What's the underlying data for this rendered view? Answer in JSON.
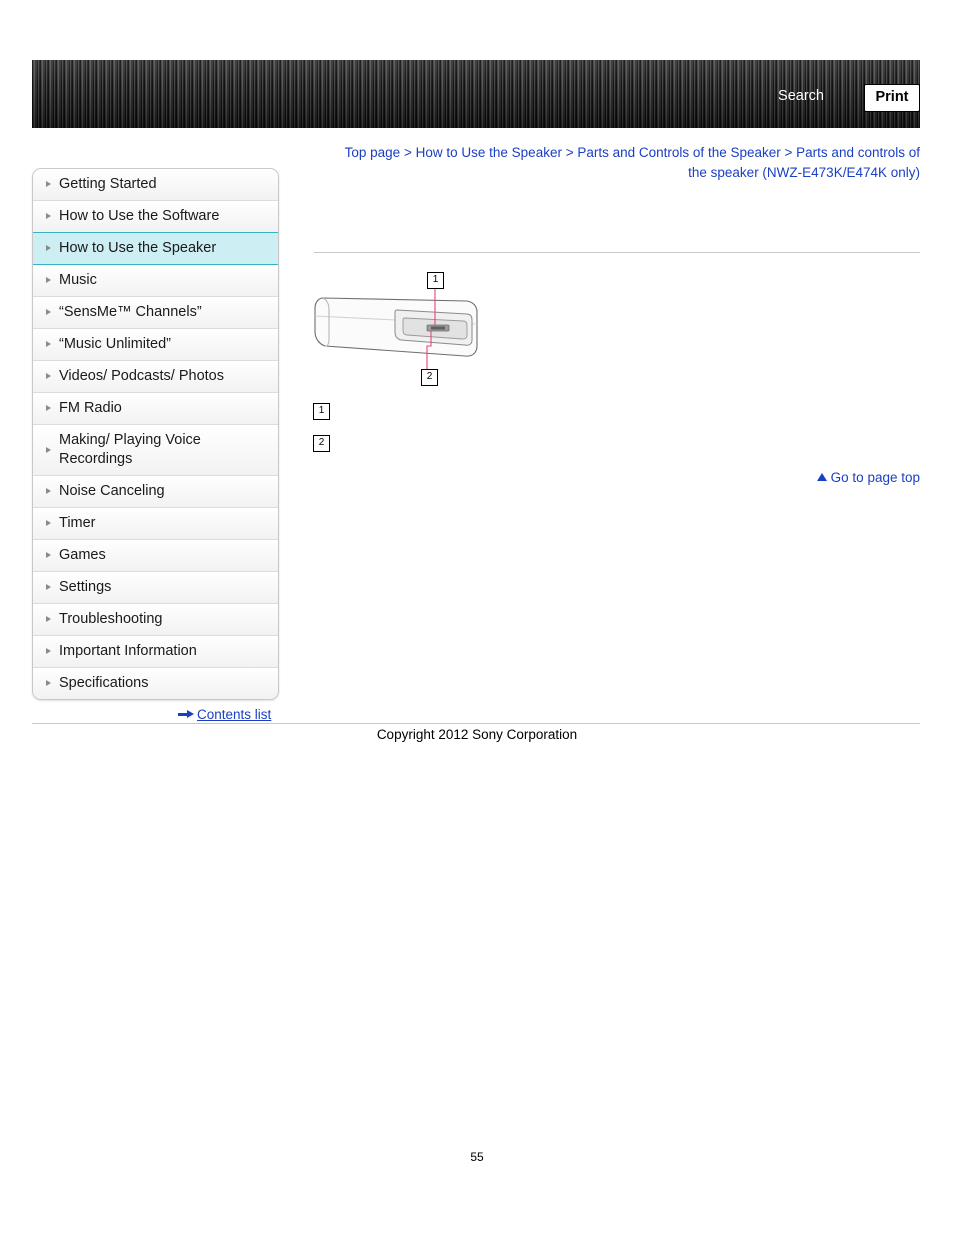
{
  "header": {
    "search_label": "Search",
    "print_label": "Print"
  },
  "breadcrumb": {
    "items": [
      "Top page",
      "How to Use the Speaker",
      "Parts and Controls of the Speaker",
      "Parts and controls of the speaker (NWZ-E473K/E474K only)"
    ],
    "separator": ">"
  },
  "sidebar": {
    "items": [
      {
        "label": "Getting Started",
        "active": false
      },
      {
        "label": "How to Use the Software",
        "active": false
      },
      {
        "label": "How to Use the Speaker",
        "active": true
      },
      {
        "label": "Music",
        "active": false
      },
      {
        "label": "“SensMe™ Channels”",
        "active": false
      },
      {
        "label": "“Music Unlimited”",
        "active": false
      },
      {
        "label": "Videos/ Podcasts/ Photos",
        "active": false
      },
      {
        "label": "FM Radio",
        "active": false
      },
      {
        "label": "Making/ Playing Voice Recordings",
        "active": false
      },
      {
        "label": "Noise Canceling",
        "active": false
      },
      {
        "label": "Timer",
        "active": false
      },
      {
        "label": "Games",
        "active": false
      },
      {
        "label": "Settings",
        "active": false
      },
      {
        "label": "Troubleshooting",
        "active": false
      },
      {
        "label": "Important Information",
        "active": false
      },
      {
        "label": "Specifications",
        "active": false
      }
    ],
    "contents_list_label": "Contents list"
  },
  "content": {
    "callouts": {
      "fig_1": "1",
      "fig_2": "2",
      "item_1": "1",
      "item_2": "2"
    },
    "go_to_page_top": "Go to page top"
  },
  "footer": {
    "copyright": "Copyright 2012 Sony Corporation",
    "page_number": "55"
  }
}
